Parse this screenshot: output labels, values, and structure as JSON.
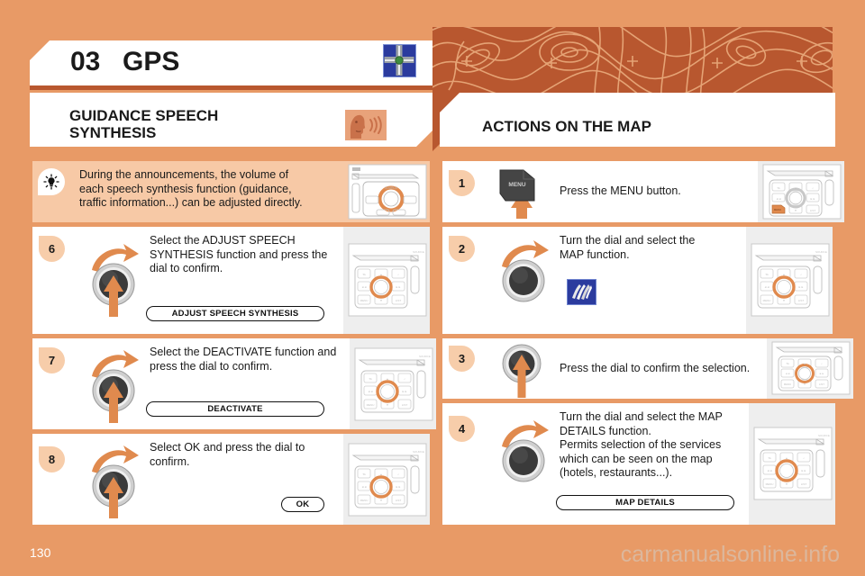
{
  "chapter": {
    "number": "03",
    "title": "GPS",
    "icon": "gps-crossroads-icon"
  },
  "sections": {
    "left": {
      "title": "GUIDANCE SPEECH\nSYNTHESIS",
      "icon": "speech-synthesis-icon"
    },
    "right": {
      "title": "ACTIONS ON THE MAP"
    }
  },
  "left_column": {
    "tip": {
      "icon": "tip-bulb-icon",
      "text": "During the announcements, the volume of each speech synthesis function (guidance, traffic information...) can be adjusted directly.",
      "thumb": "radio-panel-source-icon"
    },
    "steps": [
      {
        "number": "6",
        "control": "dial-rotate-press-icon",
        "text": "Select the ADJUST SPEECH SYNTHESIS function and press the dial to confirm.",
        "pill": "ADJUST SPEECH SYNTHESIS",
        "thumb": "radio-panel-keypad-icon"
      },
      {
        "number": "7",
        "control": "dial-rotate-press-icon",
        "text": "Select the DEACTIVATE function and press the dial to confirm.",
        "pill": "DEACTIVATE",
        "thumb": "radio-panel-keypad-icon"
      },
      {
        "number": "8",
        "control": "dial-rotate-press-icon",
        "text": "Select OK and press the dial to confirm.",
        "pill": "OK",
        "thumb": "radio-panel-keypad-icon"
      }
    ]
  },
  "right_column": {
    "steps": [
      {
        "number": "1",
        "control": "menu-button-icon",
        "control_label": "MENU",
        "text": "Press the MENU button.",
        "pill": "",
        "thumb": "radio-panel-keypad-menu-icon"
      },
      {
        "number": "2",
        "control": "dial-rotate-icon",
        "text": "Turn the dial and select the MAP function.",
        "inline_icon": "map-function-icon",
        "pill": "",
        "thumb": "radio-panel-keypad-icon"
      },
      {
        "number": "3",
        "control": "dial-press-icon",
        "text": "Press the dial to confirm the selection.",
        "pill": "",
        "thumb": "radio-panel-keypad-icon"
      },
      {
        "number": "4",
        "control": "dial-rotate-icon",
        "text": "Turn the dial and select the MAP DETAILS function.\nPermits selection of the services which can be seen on the map (hotels, restaurants...).",
        "pill": "MAP DETAILS",
        "thumb": "radio-panel-keypad-icon"
      }
    ]
  },
  "footer": {
    "page_number": "130",
    "watermark": "carmanualsonline.info"
  },
  "colors": {
    "page_bg": "#e89a66",
    "topo": "#b8572f",
    "rule": "#b8572f",
    "badge": "#f7cdaa",
    "tip_bg": "#f7c9a6",
    "accent_orange": "#e08a4e",
    "icon_blue": "#2b3b9e"
  }
}
